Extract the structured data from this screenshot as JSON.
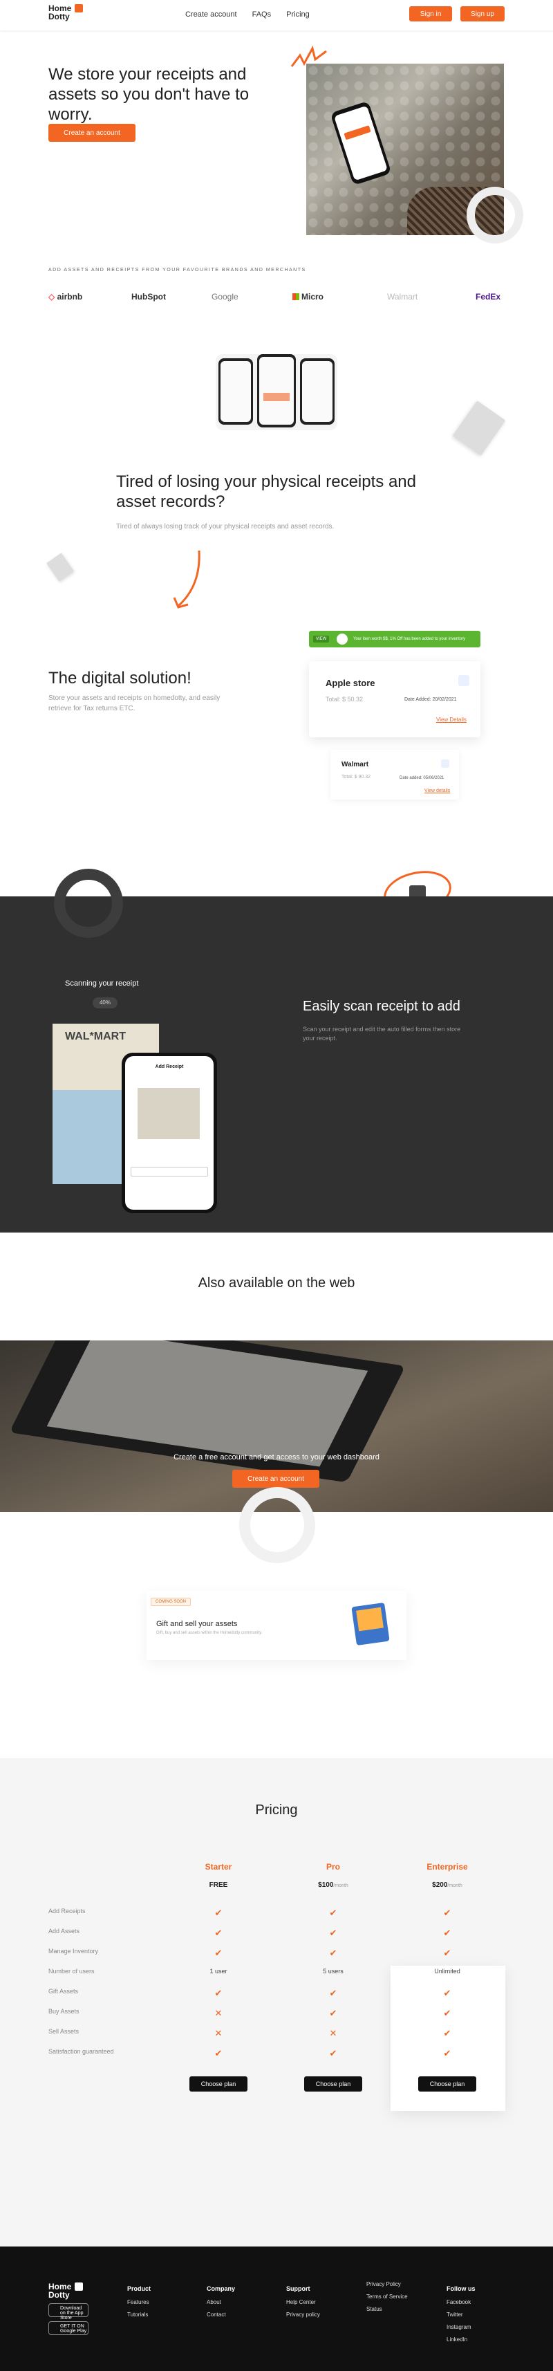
{
  "nav": {
    "logo_line1": "Home",
    "logo_line2": "Dotty",
    "links": [
      "Create account",
      "FAQs",
      "Pricing"
    ],
    "signin": "Sign in",
    "signup": "Sign up"
  },
  "hero": {
    "title": "We store your receipts and assets so you don't have to worry.",
    "cta": "Create an account"
  },
  "brands": {
    "title": "ADD ASSETS AND RECEIPTS FROM YOUR FAVOURITE BRANDS AND MERCHANTS",
    "items": [
      "airbnb",
      "HubSpot",
      "Google",
      "Micro",
      "Walmart",
      "FedEx"
    ]
  },
  "problem": {
    "title": "Tired of losing your physical receipts and asset records?",
    "subtitle": "Tired of always losing track of your physical receipts and asset records."
  },
  "solution": {
    "title": "The digital solution!",
    "desc": "Store your assets and receipts on homedotty, and easily retrieve for Tax returns ETC.",
    "banner": "Your item worth $$, 1% Off has been added to your inventory",
    "banner_tag": "VIEW",
    "card1": {
      "name": "Apple store",
      "total": "Total: $ 50.32",
      "date": "Date Added: 20/02/2021",
      "link": "View Details"
    },
    "card2": {
      "name": "Walmart",
      "total": "Total: $ 90.32",
      "date": "Date added: 05/06/2021",
      "link": "View details"
    }
  },
  "scan": {
    "label": "Scanning your receipt",
    "percent": "40%",
    "title": "Easily scan receipt to add",
    "desc": "Scan your receipt and edit the auto filled forms then store your receipt.",
    "phone_header": "Add Receipt",
    "receipt_brand": "WAL*MART"
  },
  "web": {
    "title": "Also available on the web",
    "banner_text": "Create a free account and get access to your web dashboard",
    "cta": "Create an account"
  },
  "coming": {
    "badge": "COMING SOON",
    "title": "Gift and sell your assets",
    "sub": "Gift, buy and sell assets within the Homedotty community."
  },
  "pricing": {
    "title": "Pricing",
    "plans": [
      {
        "name": "Starter",
        "price": "FREE",
        "per": ""
      },
      {
        "name": "Pro",
        "price": "$100",
        "per": "/month"
      },
      {
        "name": "Enterprise",
        "price": "$200",
        "per": "/month"
      }
    ],
    "rows": [
      {
        "label": "Add Receipts",
        "vals": [
          "check",
          "check",
          "check"
        ]
      },
      {
        "label": "Add Assets",
        "vals": [
          "check",
          "check",
          "check"
        ]
      },
      {
        "label": "Manage Inventory",
        "vals": [
          "check",
          "check",
          "check"
        ]
      },
      {
        "label": "Number of users",
        "vals": [
          "1 user",
          "5 users",
          "Unlimited"
        ]
      },
      {
        "label": "Gift Assets",
        "vals": [
          "check",
          "check",
          "check"
        ]
      },
      {
        "label": "Buy Assets",
        "vals": [
          "cross",
          "check",
          "check"
        ]
      },
      {
        "label": "Sell Assets",
        "vals": [
          "cross",
          "cross",
          "check"
        ]
      },
      {
        "label": "Satisfaction guaranteed",
        "vals": [
          "check",
          "check",
          "check"
        ]
      }
    ],
    "choose": "Choose plan"
  },
  "footer": {
    "logo_line1": "Home",
    "logo_line2": "Dotty",
    "appstore": "Download on the App Store",
    "googleplay": "GET IT ON Google Play",
    "cols": [
      {
        "title": "Product",
        "items": [
          "Features",
          "Tutorials"
        ]
      },
      {
        "title": "Company",
        "items": [
          "About",
          "Contact"
        ]
      },
      {
        "title": "Support",
        "items": [
          "Help Center",
          "Privacy policy"
        ]
      },
      {
        "title": "",
        "items": [
          "Privacy Policy",
          "Terms of Service",
          "Status"
        ]
      },
      {
        "title": "Follow us",
        "items": [
          "Facebook",
          "Twitter",
          "Instagram",
          "LinkedIn"
        ]
      }
    ]
  },
  "colors": {
    "accent": "#f26522",
    "dark": "#303030",
    "footer": "#111111",
    "green": "#5bb531"
  }
}
